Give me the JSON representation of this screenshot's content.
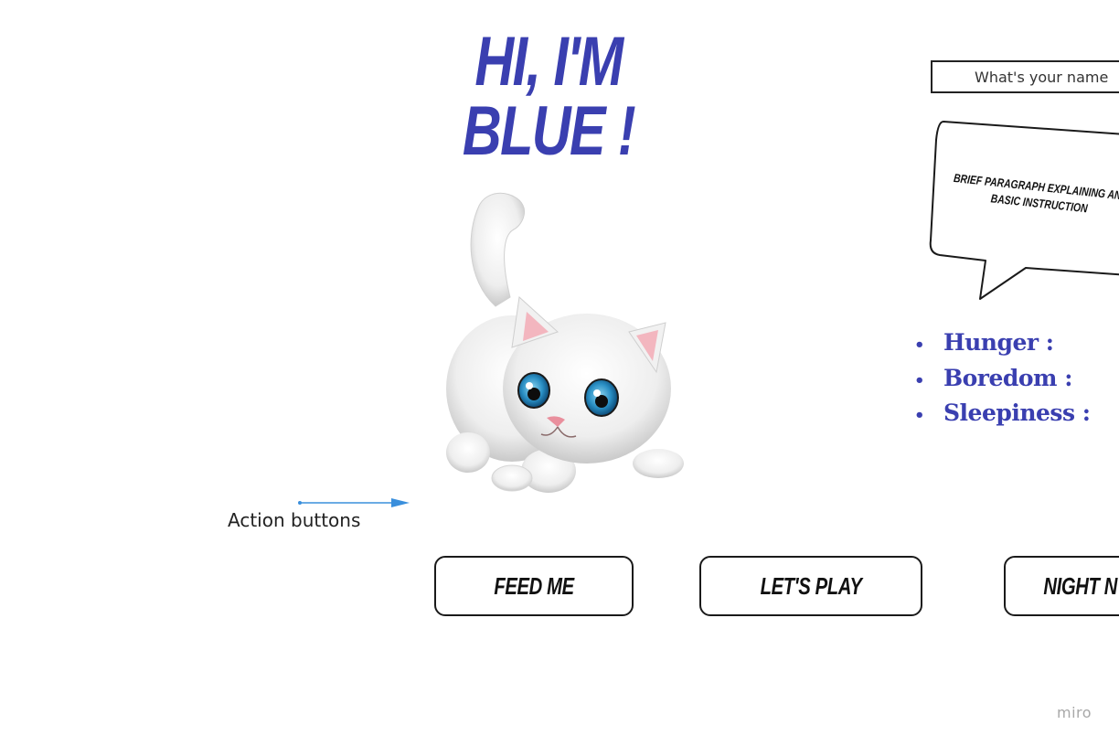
{
  "header": {
    "title": "Hi, I'm Blue !"
  },
  "name_prompt": {
    "placeholder": "What's your name"
  },
  "speech_bubble": {
    "text": "Brief paragraph explaining and basic instruction"
  },
  "stats": {
    "items": [
      {
        "label": "Hunger :"
      },
      {
        "label": "Boredom :"
      },
      {
        "label": "Sleepiness :"
      }
    ]
  },
  "annotation": {
    "label": "Action buttons"
  },
  "actions": {
    "feed": "Feed me",
    "play": "Let's play",
    "night": "Night n"
  },
  "footer": {
    "brand": "miro"
  },
  "colors": {
    "accent": "#3a3fb0",
    "arrow": "#3a8fdc",
    "border": "#1a1a1a"
  },
  "icons": {
    "pet": "white-kitten-illustration",
    "arrow": "arrow-right-icon"
  }
}
